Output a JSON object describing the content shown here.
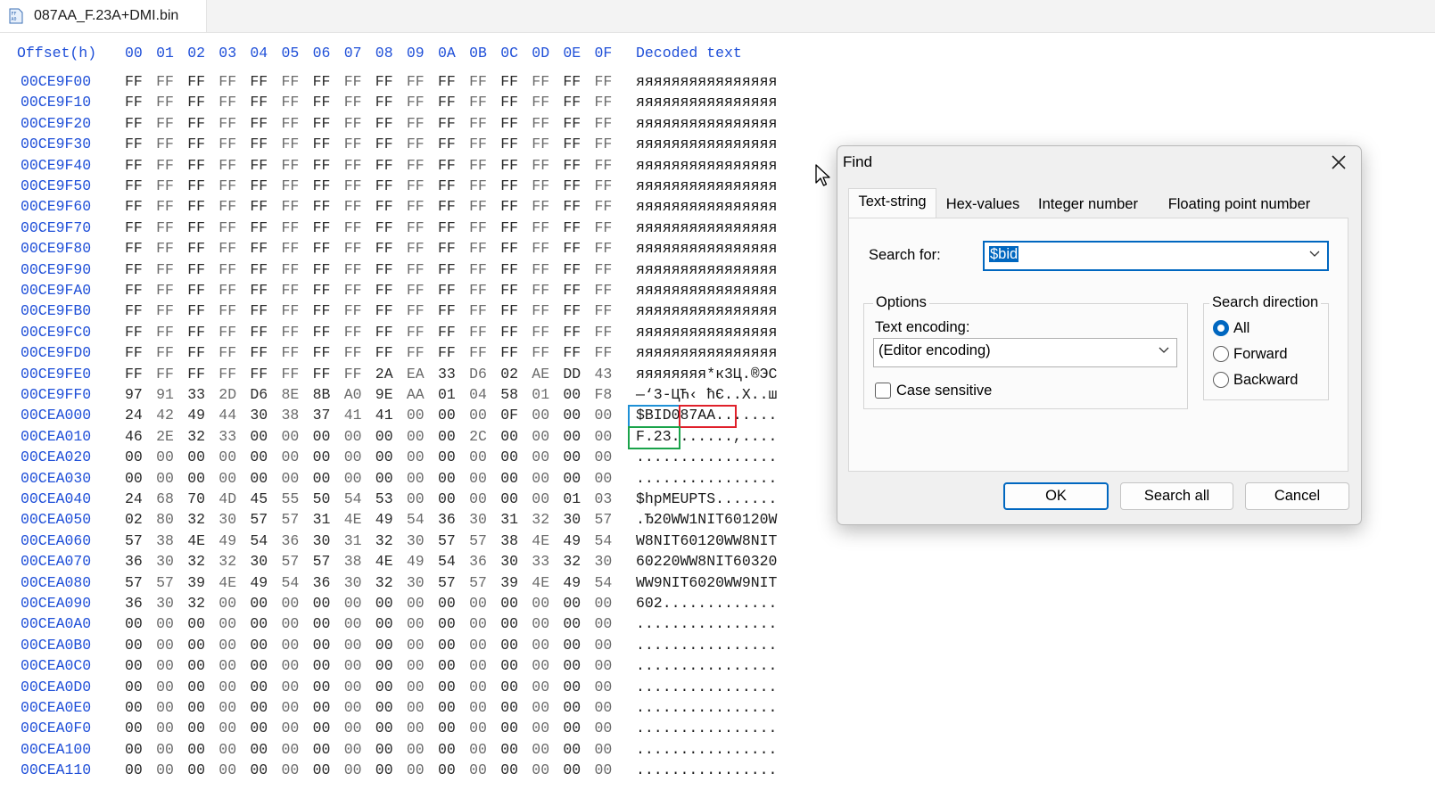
{
  "window": {
    "tab_title": "087AA_F.23A+DMI.bin",
    "tab_icon": "hex-file-icon"
  },
  "hex_view": {
    "header": {
      "offset_label": "Offset(h)",
      "columns": [
        "00",
        "01",
        "02",
        "03",
        "04",
        "05",
        "06",
        "07",
        "08",
        "09",
        "0A",
        "0B",
        "0C",
        "0D",
        "0E",
        "0F"
      ],
      "decoded_label": "Decoded text"
    },
    "rows": [
      {
        "offset": "00CE9F00",
        "bytes": [
          "FF",
          "FF",
          "FF",
          "FF",
          "FF",
          "FF",
          "FF",
          "FF",
          "FF",
          "FF",
          "FF",
          "FF",
          "FF",
          "FF",
          "FF",
          "FF"
        ],
        "text": "яяяяяяяяяяяяяяяя"
      },
      {
        "offset": "00CE9F10",
        "bytes": [
          "FF",
          "FF",
          "FF",
          "FF",
          "FF",
          "FF",
          "FF",
          "FF",
          "FF",
          "FF",
          "FF",
          "FF",
          "FF",
          "FF",
          "FF",
          "FF"
        ],
        "text": "яяяяяяяяяяяяяяяя"
      },
      {
        "offset": "00CE9F20",
        "bytes": [
          "FF",
          "FF",
          "FF",
          "FF",
          "FF",
          "FF",
          "FF",
          "FF",
          "FF",
          "FF",
          "FF",
          "FF",
          "FF",
          "FF",
          "FF",
          "FF"
        ],
        "text": "яяяяяяяяяяяяяяяя"
      },
      {
        "offset": "00CE9F30",
        "bytes": [
          "FF",
          "FF",
          "FF",
          "FF",
          "FF",
          "FF",
          "FF",
          "FF",
          "FF",
          "FF",
          "FF",
          "FF",
          "FF",
          "FF",
          "FF",
          "FF"
        ],
        "text": "яяяяяяяяяяяяяяяя"
      },
      {
        "offset": "00CE9F40",
        "bytes": [
          "FF",
          "FF",
          "FF",
          "FF",
          "FF",
          "FF",
          "FF",
          "FF",
          "FF",
          "FF",
          "FF",
          "FF",
          "FF",
          "FF",
          "FF",
          "FF"
        ],
        "text": "яяяяяяяяяяяяяяяя"
      },
      {
        "offset": "00CE9F50",
        "bytes": [
          "FF",
          "FF",
          "FF",
          "FF",
          "FF",
          "FF",
          "FF",
          "FF",
          "FF",
          "FF",
          "FF",
          "FF",
          "FF",
          "FF",
          "FF",
          "FF"
        ],
        "text": "яяяяяяяяяяяяяяяя"
      },
      {
        "offset": "00CE9F60",
        "bytes": [
          "FF",
          "FF",
          "FF",
          "FF",
          "FF",
          "FF",
          "FF",
          "FF",
          "FF",
          "FF",
          "FF",
          "FF",
          "FF",
          "FF",
          "FF",
          "FF"
        ],
        "text": "яяяяяяяяяяяяяяяя"
      },
      {
        "offset": "00CE9F70",
        "bytes": [
          "FF",
          "FF",
          "FF",
          "FF",
          "FF",
          "FF",
          "FF",
          "FF",
          "FF",
          "FF",
          "FF",
          "FF",
          "FF",
          "FF",
          "FF",
          "FF"
        ],
        "text": "яяяяяяяяяяяяяяяя"
      },
      {
        "offset": "00CE9F80",
        "bytes": [
          "FF",
          "FF",
          "FF",
          "FF",
          "FF",
          "FF",
          "FF",
          "FF",
          "FF",
          "FF",
          "FF",
          "FF",
          "FF",
          "FF",
          "FF",
          "FF"
        ],
        "text": "яяяяяяяяяяяяяяяя"
      },
      {
        "offset": "00CE9F90",
        "bytes": [
          "FF",
          "FF",
          "FF",
          "FF",
          "FF",
          "FF",
          "FF",
          "FF",
          "FF",
          "FF",
          "FF",
          "FF",
          "FF",
          "FF",
          "FF",
          "FF"
        ],
        "text": "яяяяяяяяяяяяяяяя"
      },
      {
        "offset": "00CE9FA0",
        "bytes": [
          "FF",
          "FF",
          "FF",
          "FF",
          "FF",
          "FF",
          "FF",
          "FF",
          "FF",
          "FF",
          "FF",
          "FF",
          "FF",
          "FF",
          "FF",
          "FF"
        ],
        "text": "яяяяяяяяяяяяяяяя"
      },
      {
        "offset": "00CE9FB0",
        "bytes": [
          "FF",
          "FF",
          "FF",
          "FF",
          "FF",
          "FF",
          "FF",
          "FF",
          "FF",
          "FF",
          "FF",
          "FF",
          "FF",
          "FF",
          "FF",
          "FF"
        ],
        "text": "яяяяяяяяяяяяяяяя"
      },
      {
        "offset": "00CE9FC0",
        "bytes": [
          "FF",
          "FF",
          "FF",
          "FF",
          "FF",
          "FF",
          "FF",
          "FF",
          "FF",
          "FF",
          "FF",
          "FF",
          "FF",
          "FF",
          "FF",
          "FF"
        ],
        "text": "яяяяяяяяяяяяяяяя"
      },
      {
        "offset": "00CE9FD0",
        "bytes": [
          "FF",
          "FF",
          "FF",
          "FF",
          "FF",
          "FF",
          "FF",
          "FF",
          "FF",
          "FF",
          "FF",
          "FF",
          "FF",
          "FF",
          "FF",
          "FF"
        ],
        "text": "яяяяяяяяяяяяяяяя"
      },
      {
        "offset": "00CE9FE0",
        "bytes": [
          "FF",
          "FF",
          "FF",
          "FF",
          "FF",
          "FF",
          "FF",
          "FF",
          "2A",
          "EA",
          "33",
          "D6",
          "02",
          "AE",
          "DD",
          "43"
        ],
        "text": "яяяяяяяя*к3Ц.®ЭС"
      },
      {
        "offset": "00CE9FF0",
        "bytes": [
          "97",
          "91",
          "33",
          "2D",
          "D6",
          "8E",
          "8B",
          "A0",
          "9E",
          "AA",
          "01",
          "04",
          "58",
          "01",
          "00",
          "F8"
        ],
        "text": "—‘3-ЦЋ‹ ћЄ..X..ш"
      },
      {
        "offset": "00CEA000",
        "bytes": [
          "24",
          "42",
          "49",
          "44",
          "30",
          "38",
          "37",
          "41",
          "41",
          "00",
          "00",
          "00",
          "0F",
          "00",
          "00",
          "00"
        ],
        "text": "$BID087AA......."
      },
      {
        "offset": "00CEA010",
        "bytes": [
          "46",
          "2E",
          "32",
          "33",
          "00",
          "00",
          "00",
          "00",
          "00",
          "00",
          "00",
          "2C",
          "00",
          "00",
          "00",
          "00"
        ],
        "text": "F.23.......,...."
      },
      {
        "offset": "00CEA020",
        "bytes": [
          "00",
          "00",
          "00",
          "00",
          "00",
          "00",
          "00",
          "00",
          "00",
          "00",
          "00",
          "00",
          "00",
          "00",
          "00",
          "00"
        ],
        "text": "................"
      },
      {
        "offset": "00CEA030",
        "bytes": [
          "00",
          "00",
          "00",
          "00",
          "00",
          "00",
          "00",
          "00",
          "00",
          "00",
          "00",
          "00",
          "00",
          "00",
          "00",
          "00"
        ],
        "text": "................"
      },
      {
        "offset": "00CEA040",
        "bytes": [
          "24",
          "68",
          "70",
          "4D",
          "45",
          "55",
          "50",
          "54",
          "53",
          "00",
          "00",
          "00",
          "00",
          "00",
          "01",
          "03"
        ],
        "text": "$hpMEUPTS......."
      },
      {
        "offset": "00CEA050",
        "bytes": [
          "02",
          "80",
          "32",
          "30",
          "57",
          "57",
          "31",
          "4E",
          "49",
          "54",
          "36",
          "30",
          "31",
          "32",
          "30",
          "57"
        ],
        "text": ".Ђ20WW1NIT60120W"
      },
      {
        "offset": "00CEA060",
        "bytes": [
          "57",
          "38",
          "4E",
          "49",
          "54",
          "36",
          "30",
          "31",
          "32",
          "30",
          "57",
          "57",
          "38",
          "4E",
          "49",
          "54"
        ],
        "text": "W8NIT60120WW8NIT"
      },
      {
        "offset": "00CEA070",
        "bytes": [
          "36",
          "30",
          "32",
          "32",
          "30",
          "57",
          "57",
          "38",
          "4E",
          "49",
          "54",
          "36",
          "30",
          "33",
          "32",
          "30"
        ],
        "text": "60220WW8NIT60320"
      },
      {
        "offset": "00CEA080",
        "bytes": [
          "57",
          "57",
          "39",
          "4E",
          "49",
          "54",
          "36",
          "30",
          "32",
          "30",
          "57",
          "57",
          "39",
          "4E",
          "49",
          "54"
        ],
        "text": "WW9NIT6020WW9NIT"
      },
      {
        "offset": "00CEA090",
        "bytes": [
          "36",
          "30",
          "32",
          "00",
          "00",
          "00",
          "00",
          "00",
          "00",
          "00",
          "00",
          "00",
          "00",
          "00",
          "00",
          "00"
        ],
        "text": "602............."
      },
      {
        "offset": "00CEA0A0",
        "bytes": [
          "00",
          "00",
          "00",
          "00",
          "00",
          "00",
          "00",
          "00",
          "00",
          "00",
          "00",
          "00",
          "00",
          "00",
          "00",
          "00"
        ],
        "text": "................"
      },
      {
        "offset": "00CEA0B0",
        "bytes": [
          "00",
          "00",
          "00",
          "00",
          "00",
          "00",
          "00",
          "00",
          "00",
          "00",
          "00",
          "00",
          "00",
          "00",
          "00",
          "00"
        ],
        "text": "................"
      },
      {
        "offset": "00CEA0C0",
        "bytes": [
          "00",
          "00",
          "00",
          "00",
          "00",
          "00",
          "00",
          "00",
          "00",
          "00",
          "00",
          "00",
          "00",
          "00",
          "00",
          "00"
        ],
        "text": "................"
      },
      {
        "offset": "00CEA0D0",
        "bytes": [
          "00",
          "00",
          "00",
          "00",
          "00",
          "00",
          "00",
          "00",
          "00",
          "00",
          "00",
          "00",
          "00",
          "00",
          "00",
          "00"
        ],
        "text": "................"
      },
      {
        "offset": "00CEA0E0",
        "bytes": [
          "00",
          "00",
          "00",
          "00",
          "00",
          "00",
          "00",
          "00",
          "00",
          "00",
          "00",
          "00",
          "00",
          "00",
          "00",
          "00"
        ],
        "text": "................"
      },
      {
        "offset": "00CEA0F0",
        "bytes": [
          "00",
          "00",
          "00",
          "00",
          "00",
          "00",
          "00",
          "00",
          "00",
          "00",
          "00",
          "00",
          "00",
          "00",
          "00",
          "00"
        ],
        "text": "................"
      },
      {
        "offset": "00CEA100",
        "bytes": [
          "00",
          "00",
          "00",
          "00",
          "00",
          "00",
          "00",
          "00",
          "00",
          "00",
          "00",
          "00",
          "00",
          "00",
          "00",
          "00"
        ],
        "text": "................"
      },
      {
        "offset": "00CEA110",
        "bytes": [
          "00",
          "00",
          "00",
          "00",
          "00",
          "00",
          "00",
          "00",
          "00",
          "00",
          "00",
          "00",
          "00",
          "00",
          "00",
          "00"
        ],
        "text": "................"
      }
    ],
    "highlights": [
      {
        "name": "bid-highlight",
        "color": "#1e90d6"
      },
      {
        "name": "model-highlight",
        "color": "#e0202a"
      },
      {
        "name": "version-highlight",
        "color": "#1aa34a"
      }
    ]
  },
  "find_dialog": {
    "title": "Find",
    "tabs": [
      "Text-string",
      "Hex-values",
      "Integer number",
      "Floating point number"
    ],
    "active_tab": "Text-string",
    "search_for_label": "Search for:",
    "search_value": "$bid",
    "options_group": "Options",
    "text_encoding_label": "Text encoding:",
    "text_encoding_value": "(Editor encoding)",
    "case_sensitive_label": "Case sensitive",
    "case_sensitive_checked": false,
    "direction_group": "Search direction",
    "direction_options": [
      "All",
      "Forward",
      "Backward"
    ],
    "direction_selected": "All",
    "buttons": {
      "ok": "OK",
      "search_all": "Search all",
      "cancel": "Cancel"
    },
    "accent_color": "#0067c0"
  }
}
